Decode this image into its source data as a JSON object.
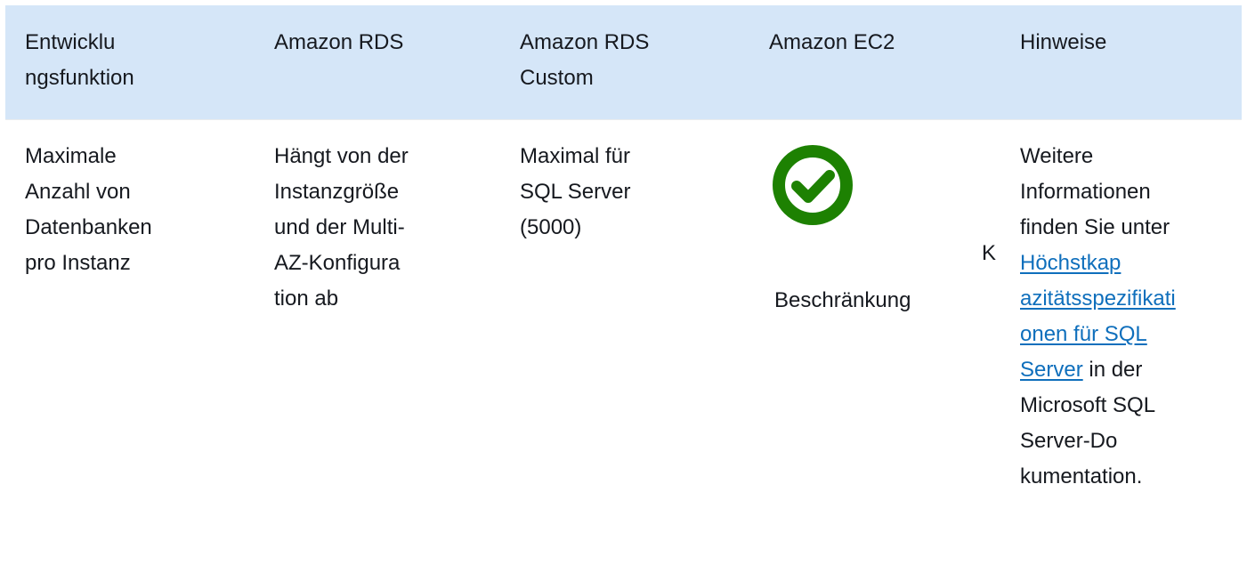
{
  "table": {
    "headers": [
      [
        "Entwicklu",
        "ngsfunktion"
      ],
      [
        "Amazon RDS"
      ],
      [
        "Amazon RDS",
        "Custom"
      ],
      [
        "Amazon EC2"
      ],
      [
        "Hinweise"
      ]
    ],
    "row": {
      "feature": [
        "Maximale",
        "Anzahl von",
        "Datenbanken",
        "pro Instanz"
      ],
      "rds": [
        "Hängt von der",
        "Instanzgröße",
        "und der Multi-",
        "AZ-Konfigura",
        "tion ab"
      ],
      "rds_custom": [
        "Maximal für",
        "SQL Server",
        "(5000)"
      ],
      "ec2": {
        "icon": "check-circle-icon",
        "icon_color": "#1d8102",
        "label": "Beschränkung",
        "stray_char": "K"
      },
      "notes": {
        "pre": [
          "Weitere",
          "Informationen",
          "finden Sie unter"
        ],
        "link": [
          "Höchstkap",
          "azitätsspezifikati",
          "onen für SQL",
          "Server"
        ],
        "post_same_line": " in der",
        "post": [
          "Microsoft SQL",
          "Server-Do",
          "kumentation."
        ]
      }
    }
  },
  "colors": {
    "header_bg": "#d5e6f8",
    "link": "#0f6fbc",
    "text": "#16191f"
  }
}
